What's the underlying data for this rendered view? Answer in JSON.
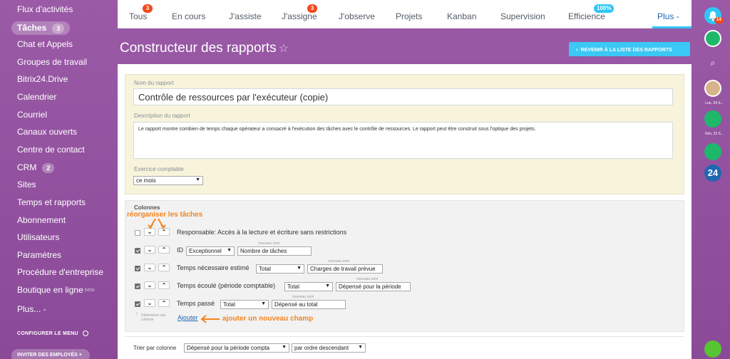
{
  "sidebar": {
    "items": [
      {
        "label": "Flux d'activités"
      },
      {
        "label": "Tâches",
        "counter": "3"
      },
      {
        "label": "Chat et Appels"
      },
      {
        "label": "Groupes de travail"
      },
      {
        "label": "Bitrix24.Drive"
      },
      {
        "label": "Calendrier"
      },
      {
        "label": "Courriel"
      },
      {
        "label": "Canaux ouverts"
      },
      {
        "label": "Centre de contact"
      },
      {
        "label": "CRM",
        "counter": "2"
      },
      {
        "label": "Sites"
      },
      {
        "label": "Temps et rapports"
      },
      {
        "label": "Abonnement"
      },
      {
        "label": "Utilisateurs"
      },
      {
        "label": "Paramètres"
      },
      {
        "label": "Procédure d'entreprise"
      },
      {
        "label": "Boutique en ligne",
        "beta": "beta"
      },
      {
        "label": "Plus... -"
      }
    ],
    "config_menu": "CONFIGURER LE MENU",
    "invite_button": "INVITER DES EMPLOYÉS +"
  },
  "tabs": [
    {
      "label": "Tous",
      "badge": "3"
    },
    {
      "label": "En cours"
    },
    {
      "label": "J'assiste"
    },
    {
      "label": "J'assigne",
      "badge": "3"
    },
    {
      "label": "J'observe"
    },
    {
      "label": "Projets"
    },
    {
      "label": "Kanban"
    },
    {
      "label": "Supervision"
    },
    {
      "label": "Efficience",
      "badge": "100%"
    },
    {
      "label": "Plus -"
    }
  ],
  "page": {
    "title": "Constructeur des rapports",
    "back_button": "REVENIR À LA LISTE DES RAPPORTS"
  },
  "form": {
    "name_label": "Nom du rapport",
    "name_value": "Contrôle de ressources par l'exécuteur (copie)",
    "description_label": "Description du rapport",
    "description_value": "Le rapport montre combien de temps chaque opérateur a consacré à l'exécution des tâches avec le contrôle de ressources. Le rapport peut être construit sous l'optique des projets.",
    "period_label": "Exercice comptable",
    "period_value": "ce mois"
  },
  "columns": {
    "title": "Colonnes",
    "rows": [
      {
        "label": "Responsable: Accès à la lecture et écriture sans restrictions",
        "checked": false
      },
      {
        "label": "ID",
        "checked": true,
        "aggregate": "Exceptionnel",
        "new_name_label": "nouveau nom",
        "new_name": "Nombre de tâches"
      },
      {
        "label": "Temps nécessaire estimé",
        "checked": true,
        "aggregate": "Total",
        "new_name_label": "nouveau nom",
        "new_name": "Charges de travail prévue"
      },
      {
        "label": "Temps écoulé (période comptable)",
        "checked": true,
        "aggregate": "Total",
        "new_name_label": "nouveau nom",
        "new_name": "Dépensé pour la période"
      },
      {
        "label": "Temps passé",
        "checked": true,
        "aggregate": "Total",
        "new_name_label": "nouveau nom",
        "new_name": "Dépensé au total"
      }
    ],
    "hint": "Déterminer une colonne",
    "add_link": "Ajouter",
    "sort_label": "Trier par colonne",
    "sort_column": "Dépensé pour la période compta",
    "sort_order": "par ordre descendant"
  },
  "annotations": {
    "reorder": "réorganiser les tâches",
    "add_field": "ajouter un nouveau champ"
  },
  "rightbar": {
    "notif_badge": "14",
    "date1": "Lun, 24 S...",
    "date2": "Dim, 23 S...",
    "logo": "24"
  },
  "colors": {
    "accent": "#2fc6f6",
    "badge": "#f54819",
    "annotation": "#f5831f",
    "sidebar_bg": "#8f4f9a"
  }
}
